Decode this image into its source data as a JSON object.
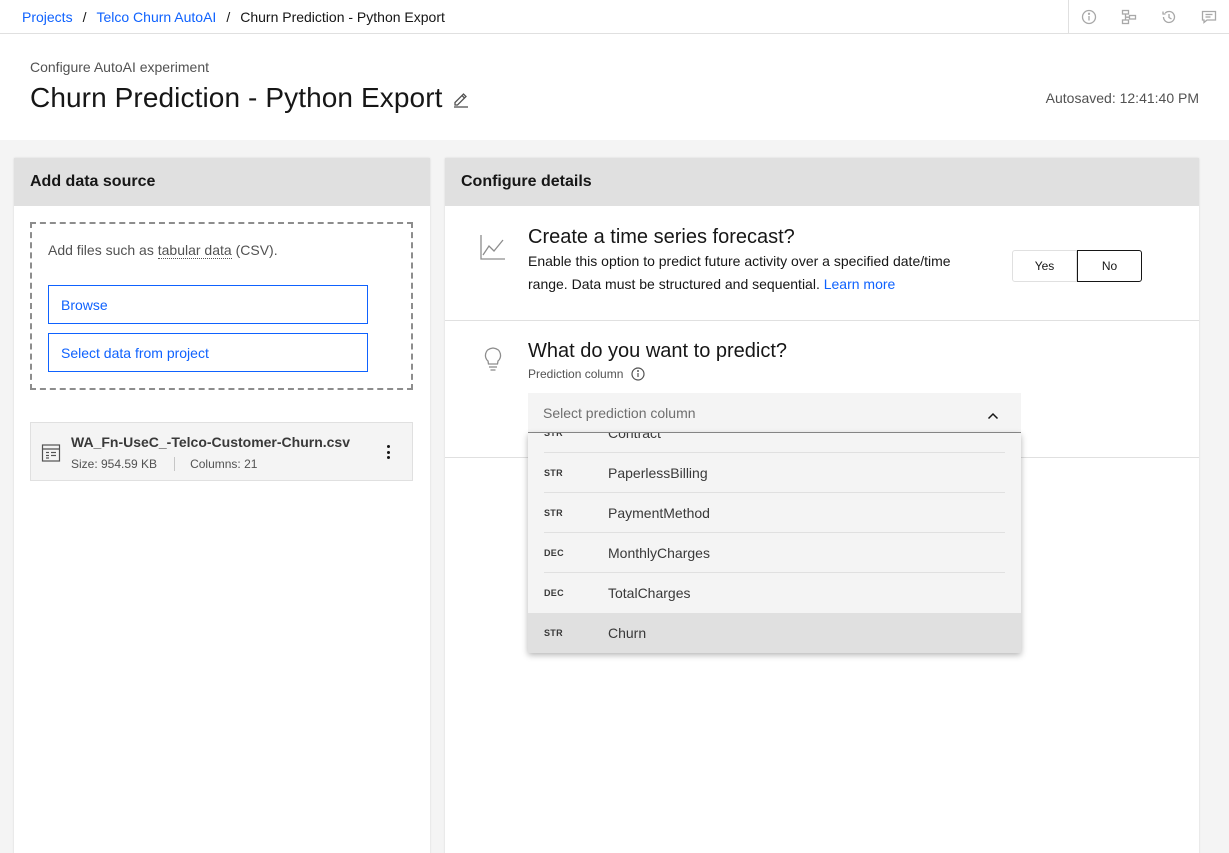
{
  "breadcrumb": {
    "items": [
      "Projects",
      "Telco Churn AutoAI"
    ],
    "current": "Churn Prediction - Python Export",
    "separator": "/"
  },
  "toolbar_icons": [
    "info-icon",
    "flow-icon",
    "history-icon",
    "comment-icon"
  ],
  "header": {
    "subtitle": "Configure AutoAI experiment",
    "title": "Churn Prediction - Python Export",
    "autosaved": "Autosaved: 12:41:40 PM"
  },
  "data_source": {
    "heading": "Add data source",
    "hint_prefix": "Add files such as ",
    "hint_link": "tabular data",
    "hint_suffix": " (CSV).",
    "browse_label": "Browse",
    "select_project_label": "Select data from project",
    "file": {
      "name": "WA_Fn-UseC_-Telco-Customer-Churn.csv",
      "size": "Size: 954.59 KB",
      "columns": "Columns: 21"
    }
  },
  "configure": {
    "heading": "Configure details",
    "timeseries": {
      "title": "Create a time series forecast?",
      "description": "Enable this option to predict future activity over a specified date/time range. Data must be structured and sequential. ",
      "learn_more": "Learn more",
      "yes_label": "Yes",
      "no_label": "No",
      "selected": "No"
    },
    "predict": {
      "title": "What do you want to predict?",
      "label": "Prediction column",
      "placeholder": "Select prediction column",
      "options": [
        {
          "type": "STR",
          "name": "Contract"
        },
        {
          "type": "STR",
          "name": "PaperlessBilling"
        },
        {
          "type": "STR",
          "name": "PaymentMethod"
        },
        {
          "type": "DEC",
          "name": "MonthlyCharges"
        },
        {
          "type": "DEC",
          "name": "TotalCharges"
        },
        {
          "type": "STR",
          "name": "Churn"
        }
      ],
      "highlighted": "Churn"
    }
  }
}
